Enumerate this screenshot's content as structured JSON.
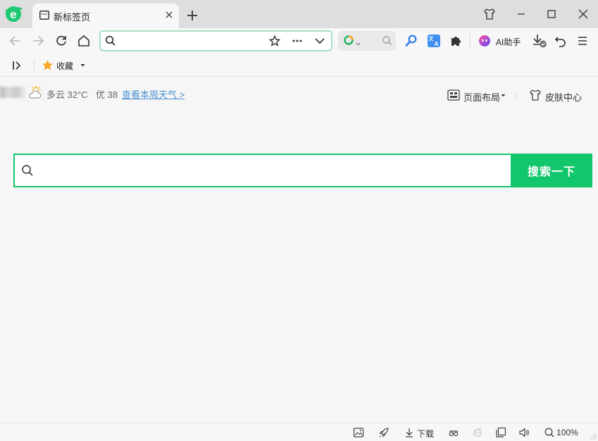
{
  "tab": {
    "title": "新标签页"
  },
  "address_bar": {
    "value": "",
    "placeholder": ""
  },
  "toolbar": {
    "ai_label": "AI助手"
  },
  "bookmarks": {
    "favorites_label": "收藏"
  },
  "weather": {
    "condition": "多云 32°C",
    "aqi": "优 38",
    "link": "查看本周天气 >"
  },
  "page_controls": {
    "layout_label": "页面布局",
    "skin_label": "皮肤中心"
  },
  "search": {
    "placeholder": "",
    "button_label": "搜索一下"
  },
  "status_bar": {
    "download_label": "下载",
    "zoom": "100%"
  },
  "colors": {
    "accent": "#12c66b",
    "link": "#4a8fd1",
    "address_border": "#a6dfc0",
    "tab_strip": "#dedede"
  },
  "icons": [
    "browser-logo-icon",
    "tab-page-icon",
    "close-icon",
    "plus-icon",
    "shirt-icon",
    "minimize-icon",
    "maximize-icon",
    "window-close-icon",
    "back-arrow-icon",
    "forward-arrow-icon",
    "reload-icon",
    "home-icon",
    "search-icon",
    "star-icon",
    "more-icon",
    "chevron-down-icon",
    "search-engine-icon",
    "magnifier-icon",
    "translate-icon",
    "puzzle-icon",
    "ai-assistant-icon",
    "download-icon",
    "undo-icon",
    "menu-icon",
    "sidebar-toggle-icon",
    "favorite-star-icon",
    "caret-down-icon",
    "weather-cloud-icon",
    "layout-icon",
    "skin-icon",
    "image-icon",
    "rocket-icon",
    "glasses-icon",
    "ie-icon",
    "window-icon",
    "volume-icon",
    "zoom-icon",
    "resize-grip-icon"
  ]
}
